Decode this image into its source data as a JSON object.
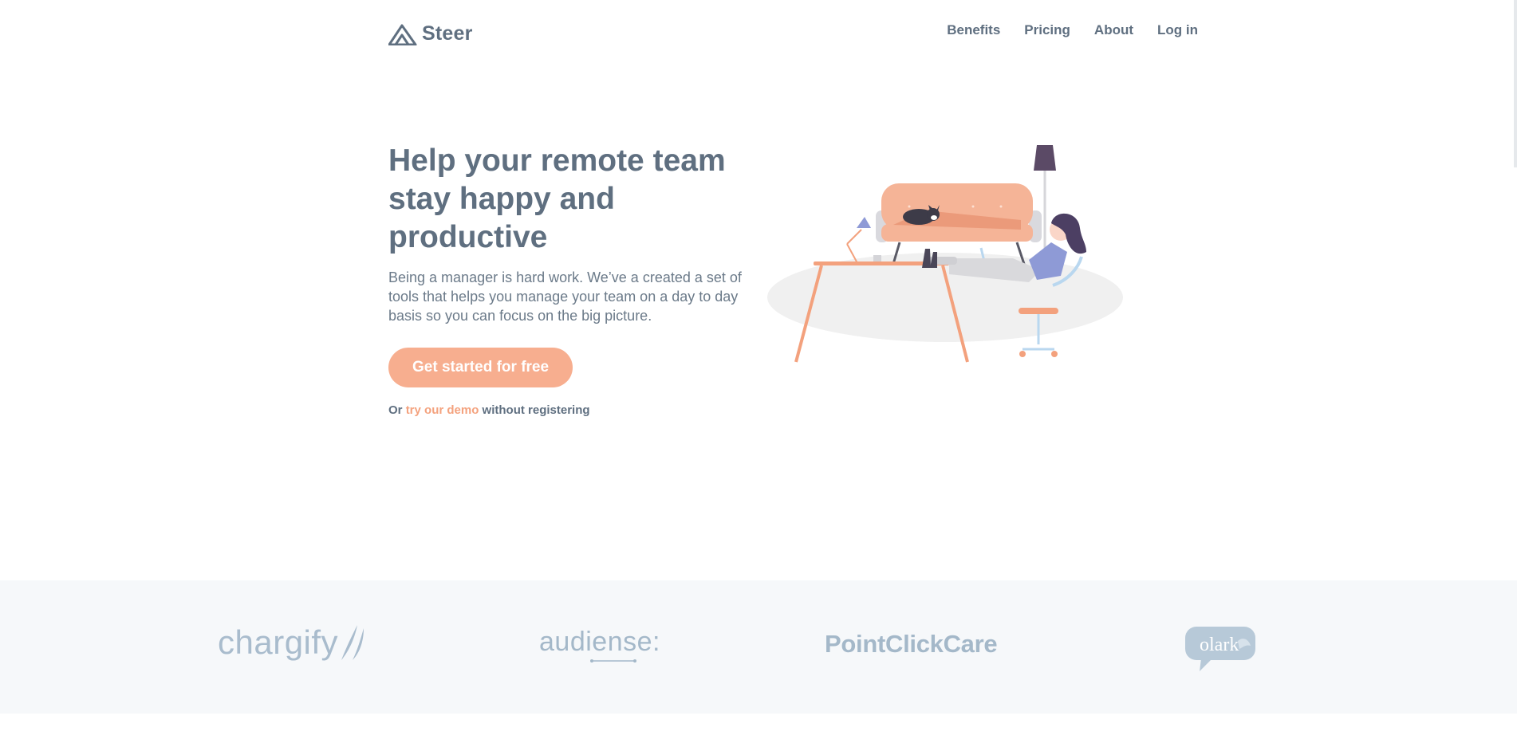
{
  "header": {
    "logo_text": "Steer",
    "nav": [
      {
        "label": "Benefits"
      },
      {
        "label": "Pricing"
      },
      {
        "label": "About"
      },
      {
        "label": "Log in"
      }
    ]
  },
  "hero": {
    "title": "Help your remote team stay happy and productive",
    "subtitle": "Being a manager is hard work. We’ve a created a set of tools that helps you manage your team on a day to day basis so you can focus on the big picture.",
    "cta_label": "Get started for free",
    "demo_prefix": "Or",
    "demo_link": "try our demo",
    "demo_suffix": "without registering"
  },
  "clients": {
    "items": [
      {
        "name": "chargify"
      },
      {
        "name": "audiense:"
      },
      {
        "name": "PointClickCare"
      },
      {
        "name": "olark"
      }
    ]
  },
  "colors": {
    "text": "#5f6f80",
    "accent": "#f7ae8f",
    "strip_bg": "#f6f8fa",
    "client_logo": "#a9bccd"
  },
  "icons": {
    "logo_mark": "mountain-triangle-icon",
    "illustration": "woman-relaxing-at-desk-illustration"
  }
}
